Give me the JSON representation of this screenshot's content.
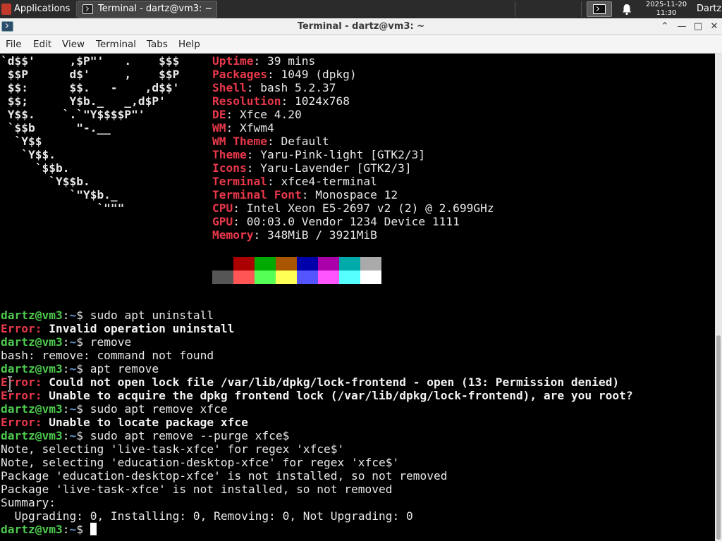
{
  "panel": {
    "applications": "Applications",
    "task_title": "Terminal - dartz@vm3: ~",
    "date": "2025-11-20",
    "time": "11:30",
    "user": "Dartz"
  },
  "window": {
    "title": "Terminal - dartz@vm3: ~",
    "buttons": {
      "shade": "⌃",
      "minimize": "—",
      "maximize": "□",
      "close": "✕"
    }
  },
  "menu": [
    "File",
    "Edit",
    "View",
    "Terminal",
    "Tabs",
    "Help"
  ],
  "neofetch": {
    "art": [
      "`d$$'     ,$P\"'   .    $$$",
      " $$P      d$'     ,    $$P",
      " $$:      $$.   -    ,d$$'",
      " $$;      Y$b._   _,d$P'",
      " Y$$.    `.`\"Y$$$$P\"'",
      " `$$b      \"-.__",
      "  `Y$$",
      "   `Y$$.",
      "     `$$b.",
      "       `Y$$b.",
      "          `\"Y$b._",
      "              `\"\"\""
    ],
    "info": [
      {
        "label": "Uptime",
        "value": "39 mins"
      },
      {
        "label": "Packages",
        "value": "1049 (dpkg)"
      },
      {
        "label": "Shell",
        "value": "bash 5.2.37"
      },
      {
        "label": "Resolution",
        "value": "1024x768"
      },
      {
        "label": "DE",
        "value": "Xfce 4.20"
      },
      {
        "label": "WM",
        "value": "Xfwm4"
      },
      {
        "label": "WM Theme",
        "value": "Default"
      },
      {
        "label": "Theme",
        "value": "Yaru-Pink-light [GTK2/3]"
      },
      {
        "label": "Icons",
        "value": "Yaru-Lavender [GTK2/3]"
      },
      {
        "label": "Terminal",
        "value": "xfce4-terminal"
      },
      {
        "label": "Terminal Font",
        "value": "Monospace 12"
      },
      {
        "label": "CPU",
        "value": "Intel Xeon E5-2697 v2 (2) @ 2.699GHz"
      },
      {
        "label": "GPU",
        "value": "00:03.0 Vendor 1234 Device 1111"
      },
      {
        "label": "Memory",
        "value": "348MiB / 3921MiB"
      }
    ],
    "palette_top": [
      "#000000",
      "#aa0000",
      "#00aa00",
      "#aa5500",
      "#0000aa",
      "#aa00aa",
      "#00aaaa",
      "#aaaaaa"
    ],
    "palette_bottom": [
      "#555555",
      "#ff5555",
      "#55ff55",
      "#ffff55",
      "#5555ff",
      "#ff55ff",
      "#55ffff",
      "#ffffff"
    ]
  },
  "prompt": {
    "user": "dartz@vm3",
    "sep": ":",
    "path": "~",
    "sym": "$ "
  },
  "session": [
    {
      "type": "cmd",
      "text": "sudo apt uninstall"
    },
    {
      "type": "err",
      "prefix": "Error:",
      "text": " Invalid operation uninstall"
    },
    {
      "type": "cmd",
      "text": "remove"
    },
    {
      "type": "out",
      "text": "bash: remove: command not found"
    },
    {
      "type": "cmd",
      "text": "apt remove"
    },
    {
      "type": "err",
      "prefix": "Error:",
      "text": " Could not open lock file /var/lib/dpkg/lock-frontend - open (13: Permission denied)"
    },
    {
      "type": "err",
      "prefix": "Error:",
      "text": " Unable to acquire the dpkg frontend lock (/var/lib/dpkg/lock-frontend), are you root?"
    },
    {
      "type": "cmd",
      "text": "sudo apt remove xfce"
    },
    {
      "type": "err",
      "prefix": "Error:",
      "text": " Unable to locate package xfce"
    },
    {
      "type": "cmd",
      "text": "sudo apt remove --purge xfce$"
    },
    {
      "type": "out",
      "text": "Note, selecting 'live-task-xfce' for regex 'xfce$'"
    },
    {
      "type": "out",
      "text": "Note, selecting 'education-desktop-xfce' for regex 'xfce$'"
    },
    {
      "type": "out",
      "text": "Package 'education-desktop-xfce' is not installed, so not removed"
    },
    {
      "type": "out",
      "text": "Package 'live-task-xfce' is not installed, so not removed"
    },
    {
      "type": "out",
      "text": "Summary:"
    },
    {
      "type": "out",
      "text": "  Upgrading: 0, Installing: 0, Removing: 0, Not Upgrading: 0"
    },
    {
      "type": "cmd",
      "text": "",
      "cursor": true
    }
  ]
}
